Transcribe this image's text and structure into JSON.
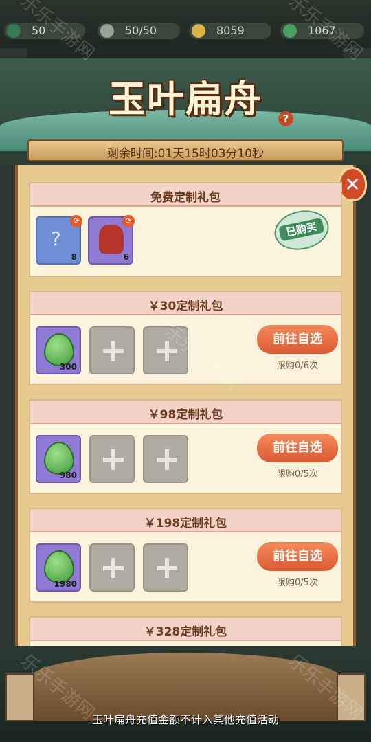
{
  "topbar": {
    "resources": [
      {
        "name": "level",
        "value": "50",
        "icon": "level-badge-icon",
        "color": "#3a7a55"
      },
      {
        "name": "stamina",
        "value": "50/50",
        "icon": "stamina-icon",
        "color": "#9aa39a"
      },
      {
        "name": "coins",
        "value": "8059",
        "icon": "coin-icon",
        "color": "#d9b44a"
      },
      {
        "name": "leaves",
        "value": "1067",
        "icon": "leaf-icon",
        "color": "#4aa062"
      }
    ]
  },
  "banner": {
    "title": "玉叶扁舟"
  },
  "timer": {
    "label": "剩余时间:01天15时03分10秒"
  },
  "packs": [
    {
      "title": "免费定制礼包",
      "items": [
        {
          "icon": "mystery-scroll-icon",
          "qty": "8"
        },
        {
          "icon": "wine-jar-icon",
          "qty": "6"
        }
      ],
      "bought_label": "已购买"
    },
    {
      "title": "￥30定制礼包",
      "items": [
        {
          "icon": "jade-leaf-icon",
          "qty": "300"
        }
      ],
      "button": "前往自选",
      "limit": "限购0/6次"
    },
    {
      "title": "￥98定制礼包",
      "items": [
        {
          "icon": "jade-leaf-icon",
          "qty": "980"
        }
      ],
      "button": "前往自选",
      "limit": "限购0/5次"
    },
    {
      "title": "￥198定制礼包",
      "items": [
        {
          "icon": "jade-leaf-icon",
          "qty": "1980"
        }
      ],
      "button": "前往自选",
      "limit": "限购0/5次"
    },
    {
      "title": "￥328定制礼包"
    }
  ],
  "footer": {
    "note": "玉叶扁舟充值金额不计入其他充值活动"
  },
  "watermark": "乐乐手游网"
}
